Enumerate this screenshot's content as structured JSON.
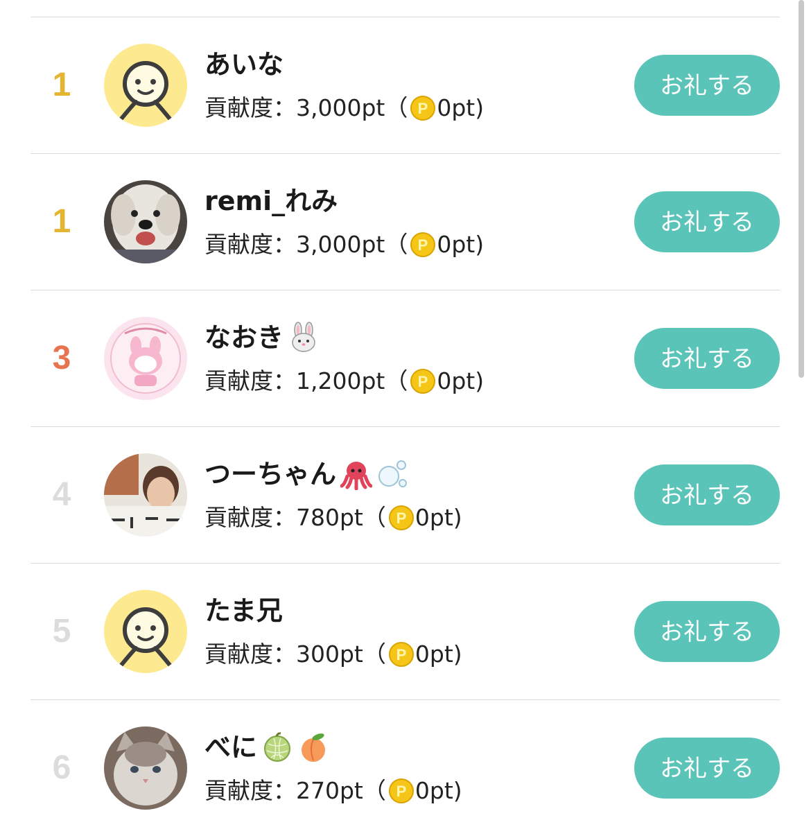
{
  "rows": [
    {
      "rank": "1",
      "rank_color": "#e3b531",
      "name": "あいな",
      "emojis": [],
      "points_label": "貢献度：",
      "points": "3,000pt",
      "open": "（",
      "coin_points": "0pt)",
      "avatar": "default-avatar",
      "button": "お礼する"
    },
    {
      "rank": "1",
      "rank_color": "#e3b531",
      "name": "remi_れみ",
      "emojis": [],
      "points_label": "貢献度：",
      "points": "3,000pt",
      "open": "（",
      "coin_points": "0pt)",
      "avatar": "dog-photo-avatar",
      "button": "お礼する"
    },
    {
      "rank": "3",
      "rank_color": "#e8734f",
      "name": "なおき",
      "emojis": [
        "rabbit-emoji"
      ],
      "points_label": "貢献度：",
      "points": "1,200pt",
      "open": "（",
      "coin_points": "0pt)",
      "avatar": "my-melody-avatar",
      "button": "お礼する"
    },
    {
      "rank": "4",
      "rank_color": "#dcdcdc",
      "name": "つーちゃん",
      "emojis": [
        "octopus-emoji",
        "bubbles-emoji"
      ],
      "points_label": "貢献度：",
      "points": "780pt",
      "open": "（",
      "coin_points": "0pt)",
      "avatar": "person-photo-avatar",
      "button": "お礼する"
    },
    {
      "rank": "5",
      "rank_color": "#dcdcdc",
      "name": "たま兄",
      "emojis": [],
      "points_label": "貢献度：",
      "points": "300pt",
      "open": "（",
      "coin_points": "0pt)",
      "avatar": "default-avatar",
      "button": "お礼する"
    },
    {
      "rank": "6",
      "rank_color": "#dcdcdc",
      "name": "べに",
      "emojis": [
        "melon-emoji",
        "peach-emoji"
      ],
      "points_label": "貢献度：",
      "points": "270pt",
      "open": "（",
      "coin_points": "0pt)",
      "avatar": "cat-photo-avatar",
      "button": "お礼する"
    }
  ],
  "colors": {
    "button_bg": "#5ac4b8",
    "coin": "#f5c518",
    "default_avatar_bg": "#fde98f"
  }
}
